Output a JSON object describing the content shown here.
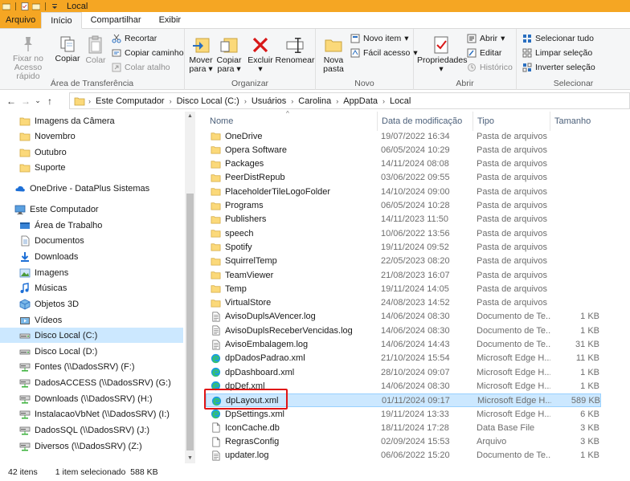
{
  "window": {
    "title": "Local"
  },
  "ribbon_tabs": [
    {
      "label": "Arquivo"
    },
    {
      "label": "Início"
    },
    {
      "label": "Compartilhar"
    },
    {
      "label": "Exibir"
    }
  ],
  "ribbon": {
    "clipboard": {
      "label": "Área de Transferência",
      "pin_label_1": "Fixar no",
      "pin_label_2": "Acesso rápido",
      "copy": "Copiar",
      "paste": "Colar",
      "cut": "Recortar",
      "copy_path": "Copiar caminho",
      "paste_shortcut": "Colar atalho"
    },
    "organize": {
      "label": "Organizar",
      "move_1": "Mover",
      "move_2": "para",
      "copy_1": "Copiar",
      "copy_2": "para",
      "delete": "Excluir",
      "rename": "Renomear"
    },
    "new": {
      "label": "Novo",
      "new_folder_1": "Nova",
      "new_folder_2": "pasta",
      "new_item": "Novo item",
      "easy_access": "Fácil acesso"
    },
    "open": {
      "label": "Abrir",
      "properties": "Propriedades",
      "open": "Abrir",
      "edit": "Editar",
      "history": "Histórico"
    },
    "select": {
      "label": "Selecionar",
      "select_all": "Selecionar tudo",
      "clear": "Limpar seleção",
      "invert": "Inverter seleção"
    }
  },
  "address": {
    "crumbs": [
      "Este Computador",
      "Disco Local (C:)",
      "Usuários",
      "Carolina",
      "AppData",
      "Local"
    ]
  },
  "nav": {
    "items": [
      {
        "label": "Imagens da Câmera",
        "icon": "folder-icon"
      },
      {
        "label": "Novembro",
        "icon": "folder-icon"
      },
      {
        "label": "Outubro",
        "icon": "folder-icon"
      },
      {
        "label": "Suporte",
        "icon": "folder-icon"
      },
      {
        "label": "OneDrive - DataPlus Sistemas",
        "icon": "cloud-icon"
      },
      {
        "label": "Este Computador",
        "icon": "computer-icon"
      },
      {
        "label": "Área de Trabalho",
        "icon": "desktop-icon"
      },
      {
        "label": "Documentos",
        "icon": "documents-icon"
      },
      {
        "label": "Downloads",
        "icon": "download-icon"
      },
      {
        "label": "Imagens",
        "icon": "pictures-icon"
      },
      {
        "label": "Músicas",
        "icon": "music-icon"
      },
      {
        "label": "Objetos 3D",
        "icon": "cube-icon"
      },
      {
        "label": "Vídeos",
        "icon": "video-icon"
      },
      {
        "label": "Disco Local (C:)",
        "icon": "drive-icon"
      },
      {
        "label": "Disco Local (D:)",
        "icon": "drive-icon"
      },
      {
        "label": "Fontes (\\\\DadosSRV) (F:)",
        "icon": "network-drive-icon"
      },
      {
        "label": "DadosACCESS (\\\\DadosSRV) (G:)",
        "icon": "network-drive-icon"
      },
      {
        "label": "Downloads (\\\\DadosSRV) (H:)",
        "icon": "network-drive-icon"
      },
      {
        "label": "InstalacaoVbNet (\\\\DadosSRV) (I:)",
        "icon": "network-drive-icon"
      },
      {
        "label": "DadosSQL (\\\\DadosSRV) (J:)",
        "icon": "network-drive-icon"
      },
      {
        "label": "Diversos (\\\\DadosSRV) (Z:)",
        "icon": "network-drive-icon"
      }
    ]
  },
  "columns": {
    "name": "Nome",
    "date": "Data de modificação",
    "type": "Tipo",
    "size": "Tamanho"
  },
  "files": [
    {
      "name": "OneDrive",
      "date": "19/07/2022 16:34",
      "type": "Pasta de arquivos",
      "size": "",
      "icon": "folder-icon"
    },
    {
      "name": "Opera Software",
      "date": "06/05/2024 10:29",
      "type": "Pasta de arquivos",
      "size": "",
      "icon": "folder-icon"
    },
    {
      "name": "Packages",
      "date": "14/11/2024 08:08",
      "type": "Pasta de arquivos",
      "size": "",
      "icon": "folder-icon"
    },
    {
      "name": "PeerDistRepub",
      "date": "03/06/2022 09:55",
      "type": "Pasta de arquivos",
      "size": "",
      "icon": "folder-icon"
    },
    {
      "name": "PlaceholderTileLogoFolder",
      "date": "14/10/2024 09:00",
      "type": "Pasta de arquivos",
      "size": "",
      "icon": "folder-icon"
    },
    {
      "name": "Programs",
      "date": "06/05/2024 10:28",
      "type": "Pasta de arquivos",
      "size": "",
      "icon": "folder-icon"
    },
    {
      "name": "Publishers",
      "date": "14/11/2023 11:50",
      "type": "Pasta de arquivos",
      "size": "",
      "icon": "folder-icon"
    },
    {
      "name": "speech",
      "date": "10/06/2022 13:56",
      "type": "Pasta de arquivos",
      "size": "",
      "icon": "folder-icon"
    },
    {
      "name": "Spotify",
      "date": "19/11/2024 09:52",
      "type": "Pasta de arquivos",
      "size": "",
      "icon": "folder-icon"
    },
    {
      "name": "SquirrelTemp",
      "date": "22/05/2023 08:20",
      "type": "Pasta de arquivos",
      "size": "",
      "icon": "folder-icon"
    },
    {
      "name": "TeamViewer",
      "date": "21/08/2023 16:07",
      "type": "Pasta de arquivos",
      "size": "",
      "icon": "folder-icon"
    },
    {
      "name": "Temp",
      "date": "19/11/2024 14:05",
      "type": "Pasta de arquivos",
      "size": "",
      "icon": "folder-icon"
    },
    {
      "name": "VirtualStore",
      "date": "24/08/2023 14:52",
      "type": "Pasta de arquivos",
      "size": "",
      "icon": "folder-icon"
    },
    {
      "name": "AvisoDuplsAVencer.log",
      "date": "14/06/2024 08:30",
      "type": "Documento de Te...",
      "size": "1 KB",
      "icon": "text-file-icon"
    },
    {
      "name": "AvisoDuplsReceberVencidas.log",
      "date": "14/06/2024 08:30",
      "type": "Documento de Te...",
      "size": "1 KB",
      "icon": "text-file-icon"
    },
    {
      "name": "AvisoEmbalagem.log",
      "date": "14/06/2024 14:43",
      "type": "Documento de Te...",
      "size": "31 KB",
      "icon": "text-file-icon"
    },
    {
      "name": "dpDadosPadrao.xml",
      "date": "21/10/2024 15:54",
      "type": "Microsoft Edge H...",
      "size": "11 KB",
      "icon": "edge-icon"
    },
    {
      "name": "dpDashboard.xml",
      "date": "28/10/2024 09:07",
      "type": "Microsoft Edge H...",
      "size": "1 KB",
      "icon": "edge-icon"
    },
    {
      "name": "dpDef.xml",
      "date": "14/06/2024 08:30",
      "type": "Microsoft Edge H...",
      "size": "1 KB",
      "icon": "edge-icon"
    },
    {
      "name": "dpLayout.xml",
      "date": "01/11/2024 09:17",
      "type": "Microsoft Edge H...",
      "size": "589 KB",
      "icon": "edge-icon",
      "selected": true
    },
    {
      "name": "DpSettings.xml",
      "date": "19/11/2024 13:33",
      "type": "Microsoft Edge H...",
      "size": "6 KB",
      "icon": "edge-icon"
    },
    {
      "name": "IconCache.db",
      "date": "18/11/2024 17:28",
      "type": "Data Base File",
      "size": "3 KB",
      "icon": "file-icon"
    },
    {
      "name": "RegrasConfig",
      "date": "02/09/2024 15:53",
      "type": "Arquivo",
      "size": "3 KB",
      "icon": "file-icon"
    },
    {
      "name": "updater.log",
      "date": "06/06/2022 15:20",
      "type": "Documento de Te...",
      "size": "1 KB",
      "icon": "text-file-icon"
    }
  ],
  "status": {
    "items_count": "42 itens",
    "selection": "1 item selecionado  588 KB"
  },
  "colors": {
    "accent_orange": "#f5a623",
    "selection_bg": "#cce8ff",
    "highlight_red": "#e01515"
  }
}
